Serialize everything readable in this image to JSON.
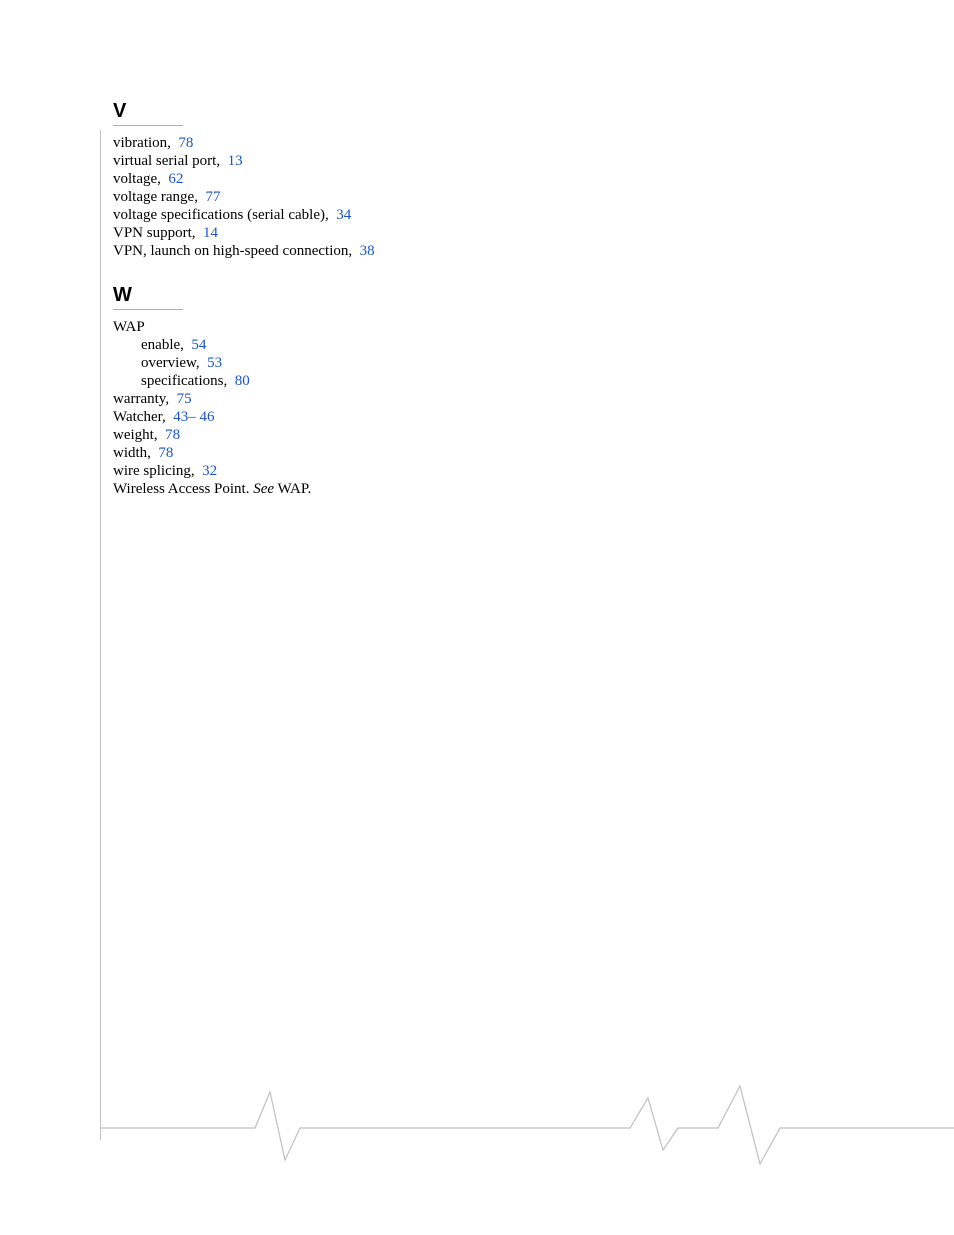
{
  "sections": {
    "V": {
      "heading": "V",
      "entries": {
        "vibration": {
          "text": "vibration",
          "sep": ",",
          "page": "78"
        },
        "virtual_serial_port": {
          "text": "virtual serial port",
          "sep": ",",
          "page": "13"
        },
        "voltage": {
          "text": "voltage",
          "sep": ",",
          "page": "62"
        },
        "voltage_range": {
          "text": "voltage range",
          "sep": ",",
          "page": "77"
        },
        "voltage_specs": {
          "text": "voltage specifications (serial cable)",
          "sep": ",",
          "page": "34"
        },
        "vpn_support": {
          "text": "VPN support",
          "sep": ",",
          "page": "14"
        },
        "vpn_launch": {
          "text": "VPN, launch on high-speed connection",
          "sep": ",",
          "page": "38"
        }
      }
    },
    "W": {
      "heading": "W",
      "wap_label": "WAP",
      "wap_sub": {
        "enable": {
          "text": "enable",
          "sep": ",",
          "page": "54"
        },
        "overview": {
          "text": "overview",
          "sep": ",",
          "page": "53"
        },
        "specifications": {
          "text": "specifications",
          "sep": ",",
          "page": "80"
        }
      },
      "entries": {
        "warranty": {
          "text": "warranty",
          "sep": ",",
          "page": "75"
        },
        "watcher": {
          "text": "Watcher",
          "sep": ",",
          "page_from": "43",
          "dash": "–",
          "page_to": "46"
        },
        "weight": {
          "text": "weight",
          "sep": ",",
          "page": "78"
        },
        "width": {
          "text": "width",
          "sep": ",",
          "page": "78"
        },
        "wire_splicing": {
          "text": "wire splicing",
          "sep": ",",
          "page": "32"
        },
        "wap_see": {
          "prefix": "Wireless Access Point. ",
          "see_word": "See",
          "suffix": " WAP."
        }
      }
    }
  }
}
